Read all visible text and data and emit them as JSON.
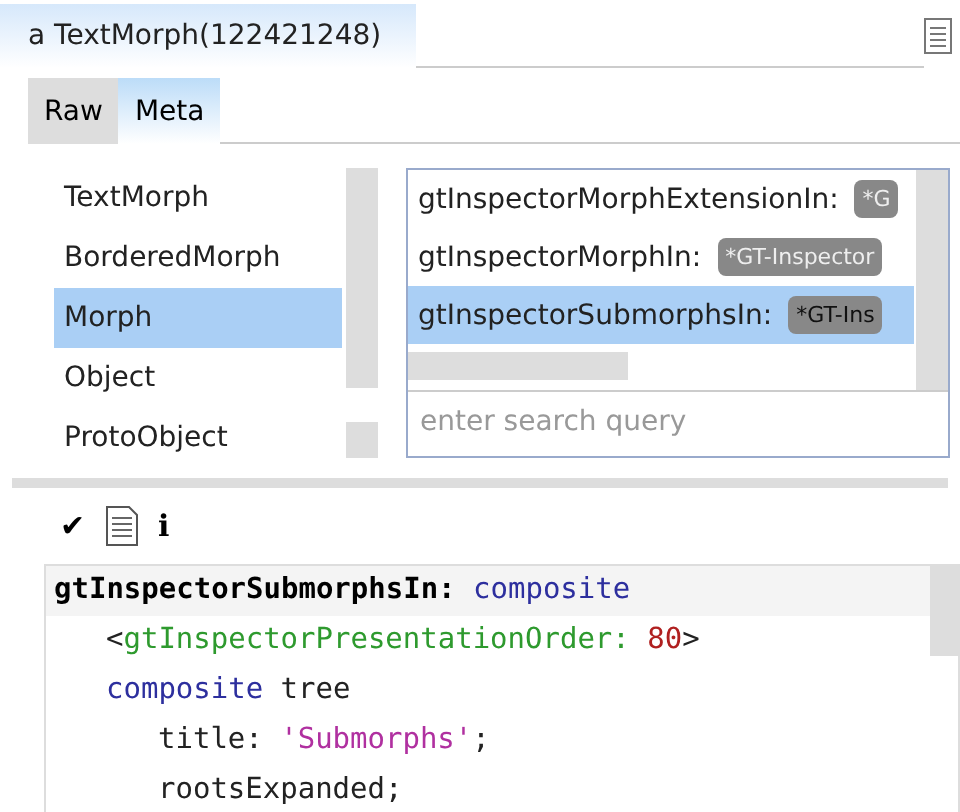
{
  "window": {
    "title": "a TextMorph(122421248)"
  },
  "tabs": [
    {
      "label": "Raw",
      "selected": false
    },
    {
      "label": "Meta",
      "selected": true
    }
  ],
  "classes": [
    {
      "label": "TextMorph",
      "selected": false
    },
    {
      "label": "BorderedMorph",
      "selected": false
    },
    {
      "label": "Morph",
      "selected": true
    },
    {
      "label": "Object",
      "selected": false
    },
    {
      "label": "ProtoObject",
      "selected": false
    }
  ],
  "methods": [
    {
      "label": "gtInspectorMorphExtensionIn:",
      "tag": "*G",
      "selected": false
    },
    {
      "label": "gtInspectorMorphIn:",
      "tag": "*GT-Inspector",
      "selected": false
    },
    {
      "label": "gtInspectorSubmorphsIn:",
      "tag": "*GT-Ins",
      "selected": true
    }
  ],
  "search": {
    "placeholder": "enter search query"
  },
  "toolbar": [
    {
      "kind": "accept",
      "label": "✔"
    },
    {
      "kind": "browse"
    },
    {
      "kind": "info",
      "label": "i"
    }
  ],
  "code": [
    {
      "tokens": [
        {
          "kind": "selector",
          "text": "gtInspectorSubmorphsIn:"
        },
        {
          "kind": "keyword",
          "text": " composite"
        }
      ],
      "children": [
        {
          "tokens": [
            {
              "kind": "plain",
              "text": "<"
            },
            {
              "kind": "pragma",
              "text": "gtInspectorPresentationOrder:"
            },
            {
              "kind": "number",
              "text": " 80"
            },
            {
              "kind": "plain",
              "text": ">"
            }
          ]
        },
        {
          "tokens": [
            {
              "kind": "keyword",
              "text": "composite"
            },
            {
              "kind": "plain",
              "text": " tree"
            }
          ],
          "children": [
            {
              "tokens": [
                {
                  "kind": "plain",
                  "text": "title: "
                },
                {
                  "kind": "string",
                  "text": "'Submorphs'"
                },
                {
                  "kind": "plain",
                  "text": ";"
                }
              ]
            },
            {
              "tokens": [
                {
                  "kind": "plain",
                  "text": "rootsExpanded;"
                }
              ]
            }
          ]
        }
      ]
    }
  ]
}
